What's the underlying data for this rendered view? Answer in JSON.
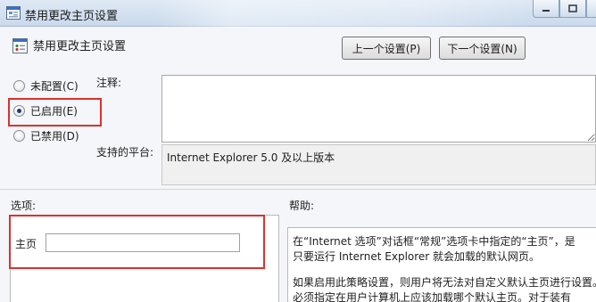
{
  "window": {
    "title": "禁用更改主页设置",
    "icon": "policy-setting-icon"
  },
  "header": {
    "title": "禁用更改主页设置",
    "icon": "policy-setting-icon"
  },
  "nav": {
    "prev_label": "上一个设置(P)",
    "next_label": "下一个设置(N)"
  },
  "state": {
    "options": [
      {
        "label": "未配置(C)",
        "selected": false
      },
      {
        "label": "已启用(E)",
        "selected": true
      },
      {
        "label": "已禁用(D)",
        "selected": false
      }
    ]
  },
  "comment": {
    "label": "注释:",
    "value": ""
  },
  "platform": {
    "label": "支持的平台:",
    "value": "Internet Explorer 5.0 及以上版本"
  },
  "options_section": {
    "label": "选项:",
    "home_label": "主页",
    "home_value": ""
  },
  "help_section": {
    "label": "帮助:",
    "lines": [
      "在“Internet 选项”对话框“常规”选项卡中指定的“主页”，是",
      "只要运行 Internet Explorer 就会加载的默认网页。",
      "如果启用此策略设置，则用户将无法对自定义默认主页进行设置。",
      "必须指定在用户计算机上应该加载哪个默认主页。对于装有"
    ]
  },
  "colors": {
    "highlight": "#d9322e",
    "titlebar": "#c9d9ec",
    "radio_selected": "#1b3c78"
  }
}
